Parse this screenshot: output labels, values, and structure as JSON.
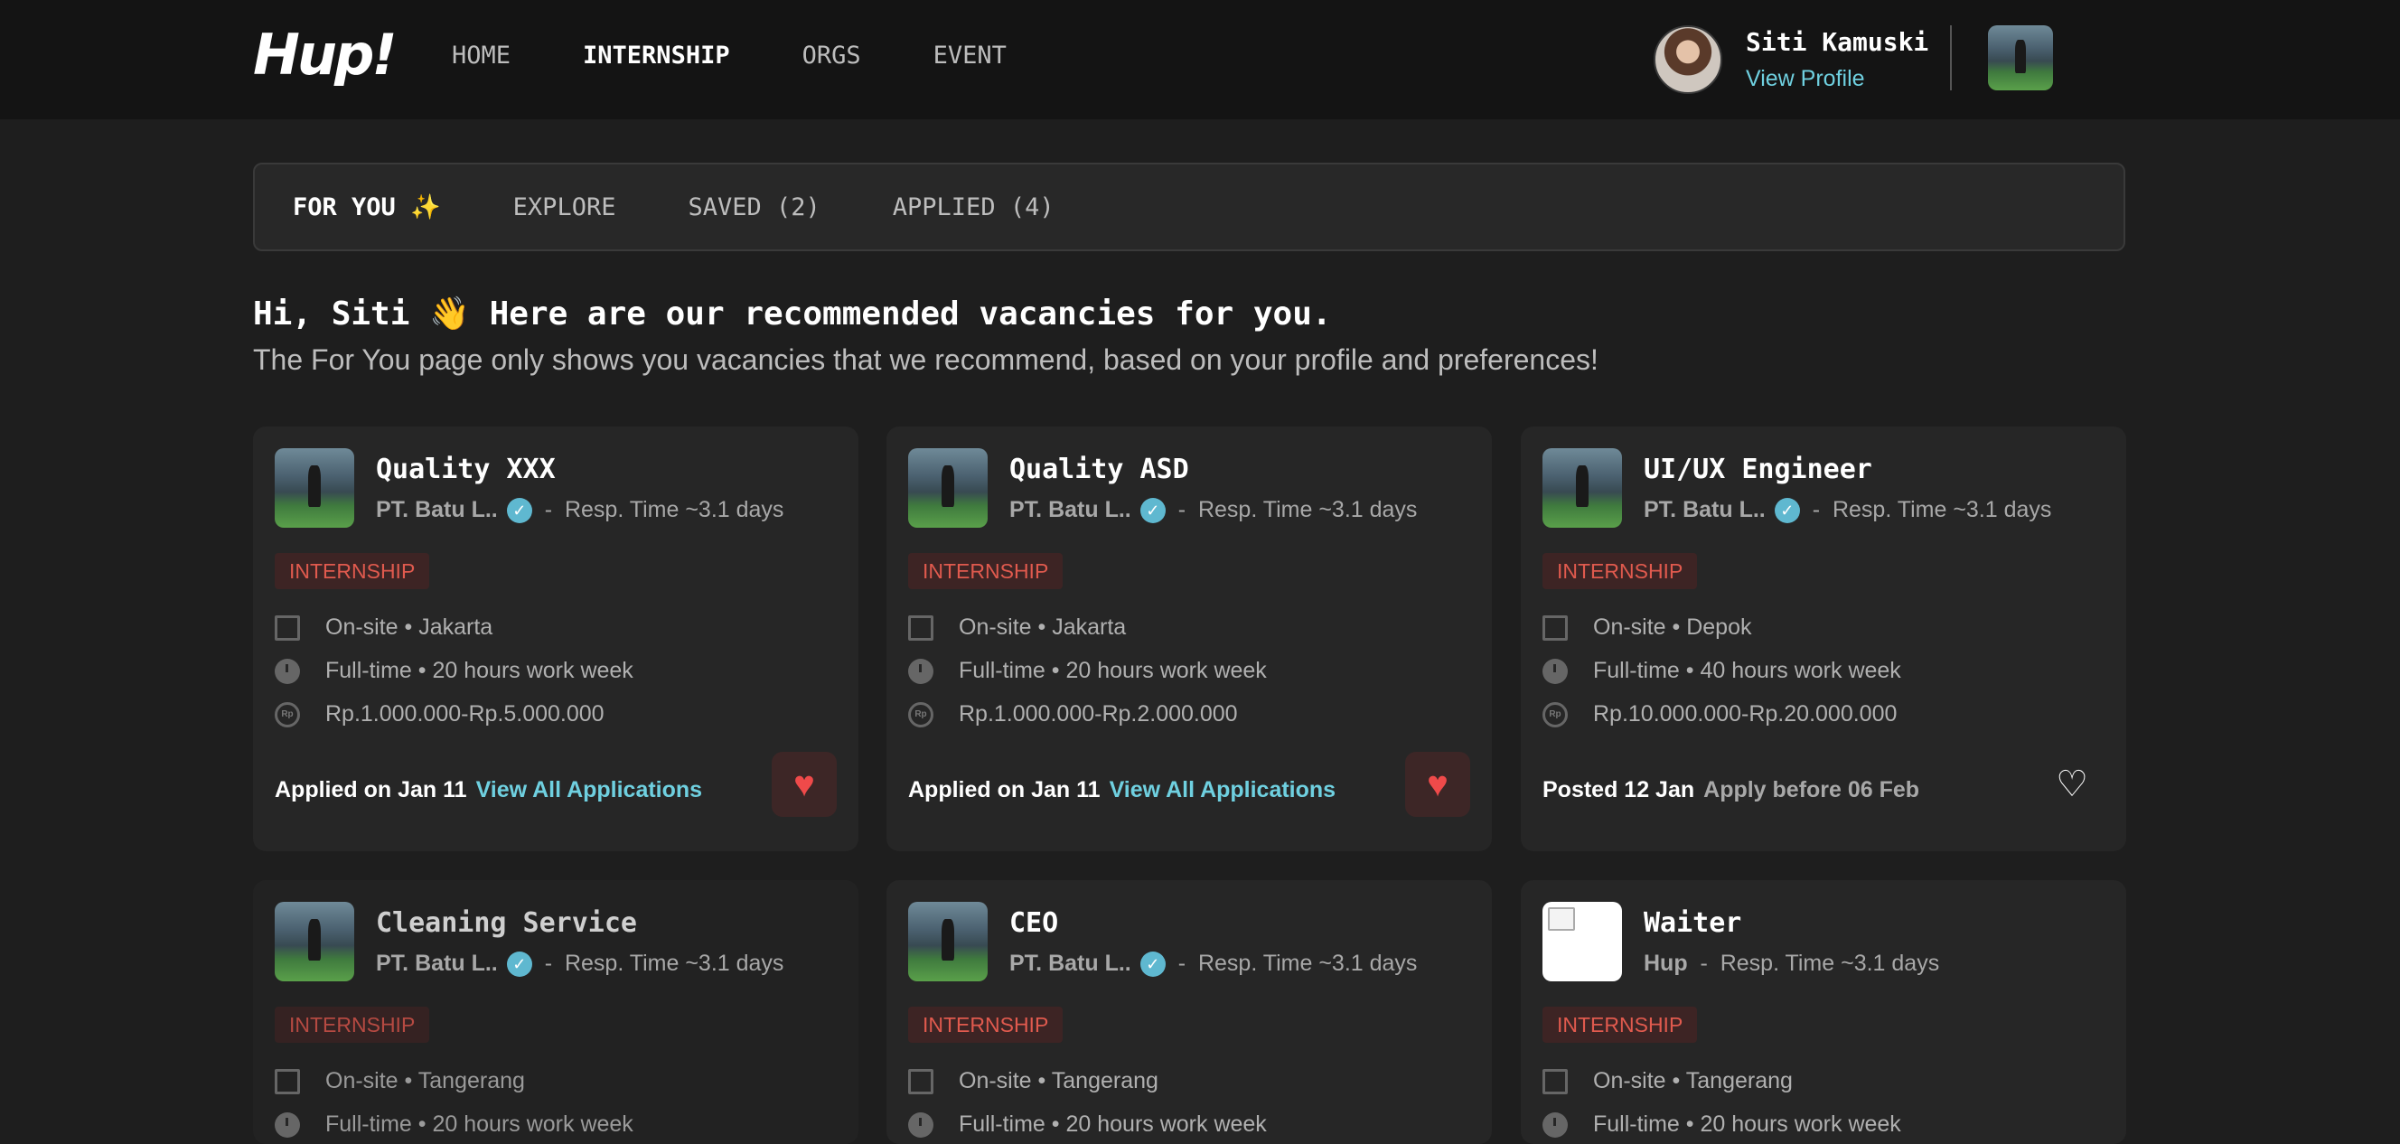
{
  "app": {
    "logo": "Hup!"
  },
  "nav": [
    "HOME",
    "INTERNSHIP",
    "ORGS",
    "EVENT"
  ],
  "profile": {
    "name": "Siti Kamuski",
    "view": "View Profile"
  },
  "tabs": [
    "FOR YOU ✨",
    "EXPLORE",
    "SAVED (2)",
    "APPLIED (4)"
  ],
  "greeting": "Hi, Siti 👋 Here are our recommended vacancies for you.",
  "subtitle": "The For You page only shows you vacancies that we recommend, based on your profile and preferences!",
  "cards": [
    {
      "title": "Quality XXX",
      "company": "PT. Batu L..",
      "resp": "Resp. Time ~3.1 days",
      "badge": "INTERNSHIP",
      "location": "On-site • Jakarta",
      "time": "Full-time • 20 hours work week",
      "salary": "Rp.1.000.000-Rp.5.000.000",
      "foot_a": "Applied on Jan 11",
      "foot_b": "View All Applications",
      "saved": true
    },
    {
      "title": "Quality ASD",
      "company": "PT. Batu L..",
      "resp": "Resp. Time ~3.1 days",
      "badge": "INTERNSHIP",
      "location": "On-site • Jakarta",
      "time": "Full-time • 20 hours work week",
      "salary": "Rp.1.000.000-Rp.2.000.000",
      "foot_a": "Applied on Jan 11",
      "foot_b": "View All Applications",
      "saved": true
    },
    {
      "title": "UI/UX Engineer",
      "company": "PT. Batu L..",
      "resp": "Resp. Time ~3.1 days",
      "badge": "INTERNSHIP",
      "location": "On-site • Depok",
      "time": "Full-time • 40 hours work week",
      "salary": "Rp.10.000.000-Rp.20.000.000",
      "foot_a": "Posted 12 Jan",
      "foot_b": "Apply before 06 Feb",
      "saved": false
    },
    {
      "title": "Cleaning Service",
      "company": "PT. Batu L..",
      "resp": "Resp. Time ~3.1 days",
      "badge": "INTERNSHIP",
      "location": "On-site • Tangerang",
      "time": "Full-time • 20 hours work week"
    },
    {
      "title": "CEO",
      "company": "PT. Batu L..",
      "resp": "Resp. Time ~3.1 days",
      "badge": "INTERNSHIP",
      "location": "On-site • Tangerang",
      "time": "Full-time • 20 hours work week"
    },
    {
      "title": "Waiter",
      "company": "Hup",
      "resp": "Resp. Time ~3.1 days",
      "badge": "INTERNSHIP",
      "location": "On-site • Tangerang",
      "time": "Full-time • 20 hours work week"
    }
  ],
  "colors": {
    "accent_link": "#6fd0e0",
    "badge_red": "#e05a4e",
    "heart": "#ef4a4a"
  },
  "icons": {
    "verified": "check-badge-icon",
    "location": "building-icon",
    "time": "clock-icon",
    "salary": "rupiah-icon",
    "save": "heart-icon"
  }
}
